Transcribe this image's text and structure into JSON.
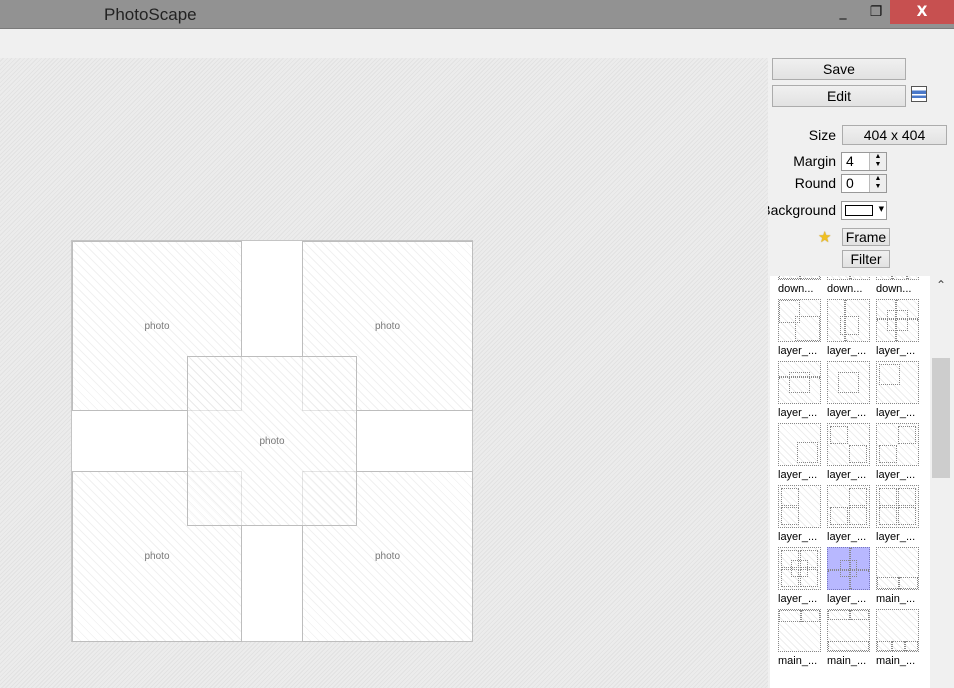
{
  "window": {
    "title": "PhotoScape",
    "minimize": "_",
    "restore": "❐",
    "close": "X"
  },
  "collage": {
    "cells": [
      {
        "label": "photo"
      },
      {
        "label": "photo"
      },
      {
        "label": "photo"
      },
      {
        "label": "photo"
      },
      {
        "label": "photo"
      }
    ]
  },
  "panel": {
    "save": "Save",
    "edit": "Edit",
    "layout_icon": "list-layout-icon",
    "size_label": "Size",
    "size_value": "404 x 404",
    "margin_label": "Margin",
    "margin_value": "4",
    "round_label": "Round",
    "round_value": "0",
    "background_label": "Background",
    "background_color": "#ffffff",
    "frame": "Frame",
    "filter": "Filter",
    "accent_star": "#f0c020"
  },
  "thumbnails": [
    {
      "label": "down..."
    },
    {
      "label": "down..."
    },
    {
      "label": "down..."
    },
    {
      "label": "layer_..."
    },
    {
      "label": "layer_..."
    },
    {
      "label": "layer_..."
    },
    {
      "label": "layer_..."
    },
    {
      "label": "layer_..."
    },
    {
      "label": "layer_..."
    },
    {
      "label": "layer_..."
    },
    {
      "label": "layer_..."
    },
    {
      "label": "layer_..."
    },
    {
      "label": "layer_..."
    },
    {
      "label": "layer_..."
    },
    {
      "label": "layer_..."
    },
    {
      "label": "layer_..."
    },
    {
      "label": "layer_...",
      "selected": true
    },
    {
      "label": "main_..."
    },
    {
      "label": "main_..."
    },
    {
      "label": "main_..."
    },
    {
      "label": "main_..."
    }
  ],
  "selected_color": "#b8b8ff"
}
